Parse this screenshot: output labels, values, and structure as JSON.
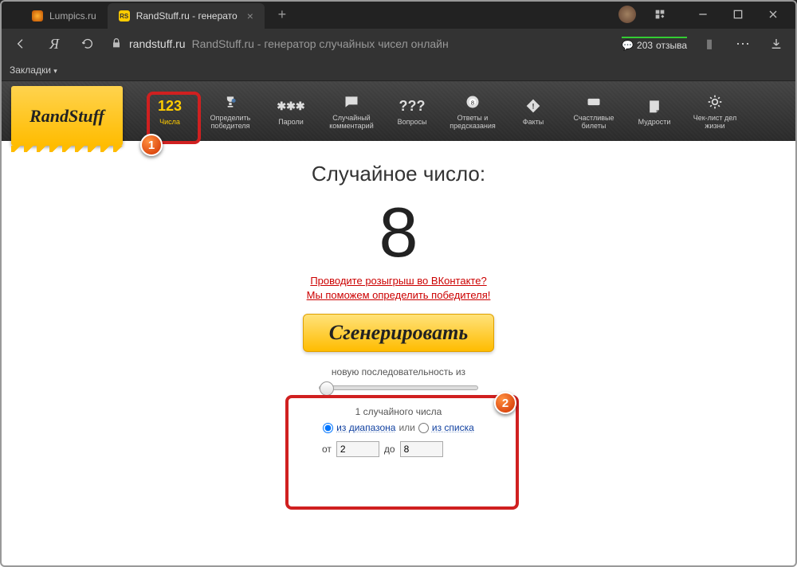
{
  "browser": {
    "tabs": [
      {
        "label": "Lumpics.ru"
      },
      {
        "label": "RandStuff.ru - генерато"
      }
    ],
    "address_domain": "randstuff.ru",
    "address_title": "RandStuff.ru - генератор случайных чисел онлайн",
    "reviews_count": "203",
    "reviews_word": "отзыва",
    "bookmarks_label": "Закладки"
  },
  "site": {
    "logo": "RandStuff",
    "nav": [
      {
        "icon_text": "123",
        "label": "Числа"
      },
      {
        "label": "Определить победителя"
      },
      {
        "icon_text": "✱✱✱",
        "label": "Пароли"
      },
      {
        "label": "Случайный комментарий"
      },
      {
        "icon_text": "???",
        "label": "Вопросы"
      },
      {
        "label": "Ответы и предсказания"
      },
      {
        "label": "Факты"
      },
      {
        "label": "Счастливые билеты"
      },
      {
        "label": "Мудрости"
      },
      {
        "label": "Чек-лист дел жизни"
      }
    ]
  },
  "page": {
    "heading": "Случайное число:",
    "result": "8",
    "promo_line1": "Проводите розыгрыш во ВКонтакте?",
    "promo_line2": "Мы поможем определить победителя!",
    "generate_btn": "Сгенерировать",
    "controls": {
      "seq_label": "новую последовательность из",
      "slider_value": "1",
      "count_label": "1 случайного числа",
      "radio_range": "из диапазона",
      "sep": "или",
      "radio_list": "из списка",
      "from_label": "от",
      "from_value": "2",
      "to_label": "до",
      "to_value": "8"
    }
  },
  "annotations": {
    "a1": "1",
    "a2": "2"
  }
}
